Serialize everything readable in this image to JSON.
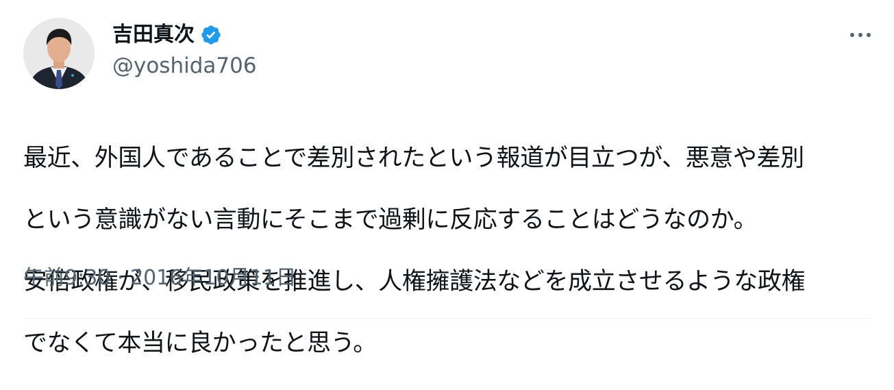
{
  "author": {
    "name": "吉田真次",
    "handle": "@yoshida706",
    "verified": true
  },
  "tweet": {
    "lines": [
      "最近、外国人であることで差別されたという報道が目立つが、悪意や差別",
      "という意識がない言動にそこまで過剰に反応することはどうなのか。",
      "安倍政権が、移民政策を推進し、人権擁護法などを成立させるような政権",
      "でなくて本当に良かったと思う。"
    ],
    "time": "午前9:30",
    "separator": " · ",
    "date": "2016年10月11日"
  },
  "colors": {
    "verified": "#1d9bf0",
    "secondary_text": "#536471",
    "primary_text": "#0f1419"
  },
  "icons": {
    "verified": "verified-badge-icon",
    "more": "more-options-icon"
  }
}
